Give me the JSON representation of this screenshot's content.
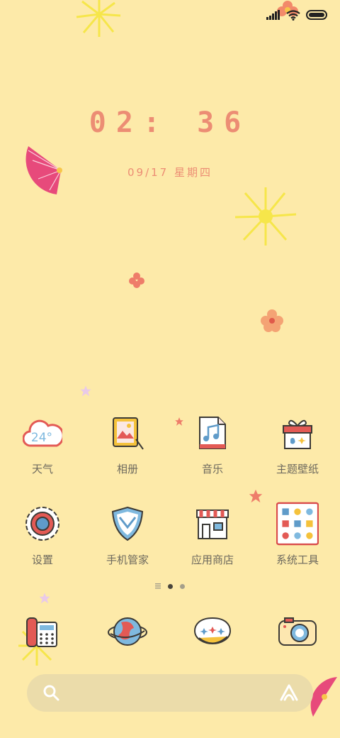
{
  "status_bar": {
    "icons": [
      "signal-icon",
      "wifi-icon",
      "battery-icon"
    ]
  },
  "lockclock": {
    "time": "02: 36",
    "date": "09/17 星期四"
  },
  "apps_row1": [
    {
      "label": "天气",
      "icon": "weather-cloud-icon",
      "temp": "24°"
    },
    {
      "label": "相册",
      "icon": "gallery-frame-icon"
    },
    {
      "label": "音乐",
      "icon": "music-note-icon"
    },
    {
      "label": "主题壁纸",
      "icon": "gift-box-icon"
    }
  ],
  "apps_row2": [
    {
      "label": "设置",
      "icon": "gear-icon"
    },
    {
      "label": "手机管家",
      "icon": "shield-icon"
    },
    {
      "label": "应用商店",
      "icon": "store-icon"
    },
    {
      "label": "系统工具",
      "icon": "tools-folder-icon"
    }
  ],
  "page_indicator": {
    "pages": 3,
    "current": 2
  },
  "dock": [
    {
      "icon": "phone-icon"
    },
    {
      "icon": "browser-globe-icon"
    },
    {
      "icon": "messages-bubble-icon"
    },
    {
      "icon": "camera-icon"
    }
  ],
  "search_bar": {
    "icons": [
      "search-icon",
      "assistant-icon"
    ]
  },
  "colors": {
    "background": "#fdeaa9",
    "accent": "#ec8d74",
    "label": "#6e6a5e"
  }
}
